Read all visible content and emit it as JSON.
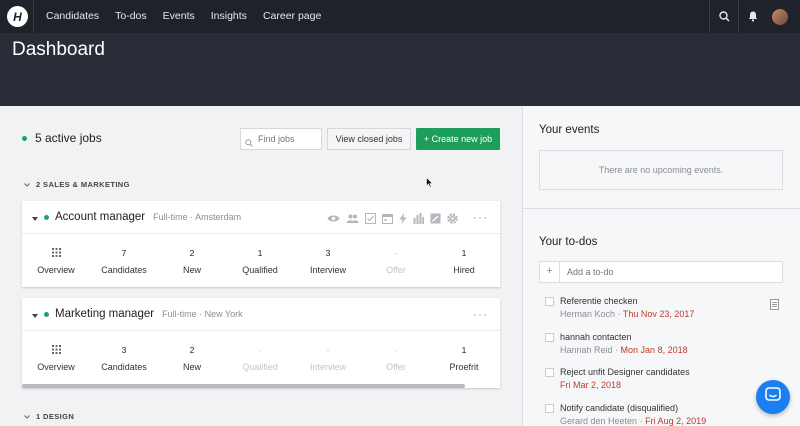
{
  "nav": {
    "logo": "H",
    "items": [
      {
        "label": "Candidates"
      },
      {
        "label": "To-dos"
      },
      {
        "label": "Events"
      },
      {
        "label": "Insights"
      },
      {
        "label": "Career page"
      }
    ]
  },
  "header": {
    "title": "Dashboard"
  },
  "jobs_toolbar": {
    "active_jobs": "5 active jobs",
    "find_placeholder": "Find jobs",
    "view_closed": "View closed jobs",
    "create_new": "+ Create new job"
  },
  "sections": [
    {
      "label": "2 SALES & MARKETING"
    },
    {
      "label": "1 DESIGN"
    }
  ],
  "jobs": [
    {
      "title": "Account manager",
      "meta": "Full-time · Amsterdam",
      "stats": [
        {
          "num": "",
          "label": "Overview"
        },
        {
          "num": "7",
          "label": "Candidates"
        },
        {
          "num": "2",
          "label": "New"
        },
        {
          "num": "1",
          "label": "Qualified"
        },
        {
          "num": "3",
          "label": "Interview"
        },
        {
          "num": "-",
          "label": "Offer"
        },
        {
          "num": "1",
          "label": "Hired"
        }
      ]
    },
    {
      "title": "Marketing manager",
      "meta": "Full-time · New York",
      "stats": [
        {
          "num": "",
          "label": "Overview"
        },
        {
          "num": "3",
          "label": "Candidates"
        },
        {
          "num": "2",
          "label": "New"
        },
        {
          "num": "-",
          "label": "Qualified"
        },
        {
          "num": "-",
          "label": "Interview"
        },
        {
          "num": "-",
          "label": "Offer"
        },
        {
          "num": "1",
          "label": "Proefrit"
        }
      ]
    }
  ],
  "events": {
    "title": "Your events",
    "empty": "There are no upcoming events."
  },
  "todos": {
    "title": "Your to-dos",
    "add_placeholder": "Add a to-do",
    "items": [
      {
        "title": "Referentie checken",
        "who": "Herman Koch",
        "when": "Thu Nov 23, 2017"
      },
      {
        "title": "hannah contacten",
        "who": "Hannah Reid",
        "when": "Mon Jan 8, 2018"
      },
      {
        "title": "Reject unfit Designer candidates",
        "who": "",
        "when": "Fri Mar 2, 2018"
      },
      {
        "title": "Notify candidate (disqualified)",
        "who": "Gerard den Heeten",
        "when": "Fri Aug 2, 2019"
      }
    ]
  },
  "colors": {
    "topbar": "#20222b",
    "header": "#2a2c37",
    "primary_green": "#1f9d5b",
    "due_red": "#c0392b",
    "chat_blue": "#1a7ff0"
  }
}
